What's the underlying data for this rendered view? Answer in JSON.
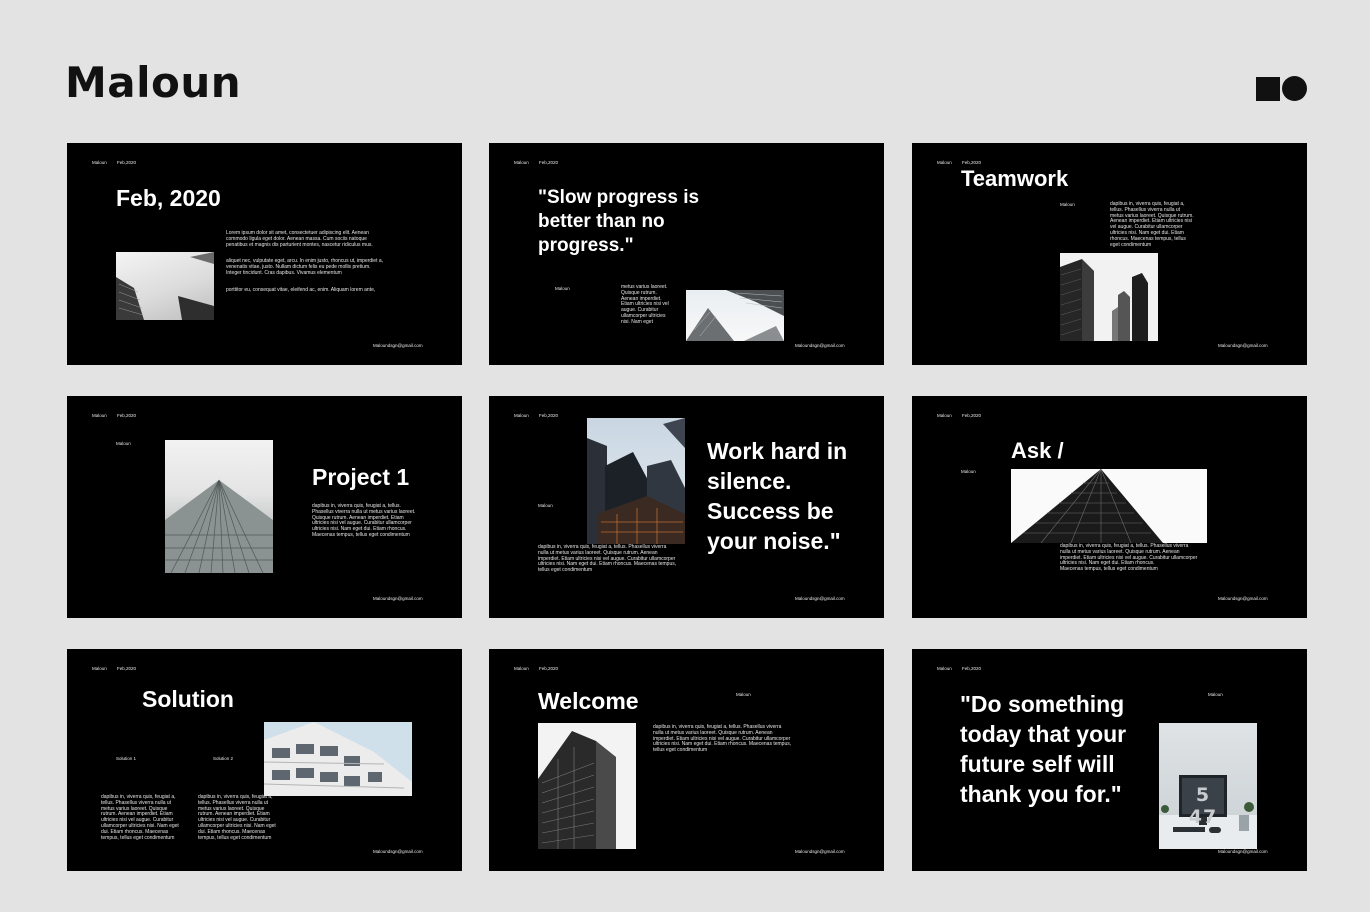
{
  "brand": "Maloun",
  "logo_icon": "square-circle-logo",
  "slide_common": {
    "brand": "Maloun",
    "date": "Feb,2020",
    "email": "Maloundsgn@gmail.com"
  },
  "slides": [
    {
      "title": "Feb, 2020",
      "paragraphs": [
        "Lorem ipsum dolor sit amet, consectetuer adipiscing elit. Aenean\ncommodo ligula eget dolor. Aenean massa. Cum sociis natoque\npenatibus et magnis dis parturient montes, nascetur ridiculus mus.",
        "aliquet nec, vulputate eget, arcu. In enim justo, rhoncus ut, imperdiet a,\nvenenatis vitae, justo. Nullam dictum felis eu pede mollis pretium.\nInteger tincidunt. Cras dapibus. Vivamus elementum",
        "porttitor eu, consequat vitae, eleifend ac, enim. Aliquam lorem ante,"
      ]
    },
    {
      "title": "\"Slow progress is\nbetter than no\nprogress.\"",
      "label": "Maloun",
      "paragraph": "metus varius laoreet.\nQuisque rutrum.\nAenean imperdiet.\nEtiam ultricies nisi vel\naugue. Curabitur\nullamcorper ultricies\nnisi. Nam eget"
    },
    {
      "title": "Teamwork",
      "label": "Maloun",
      "paragraph": "dapibus in, viverra quis, feugiat a,\ntellus. Phasellus viverra nulla ut\nmetus varius laoreet. Quisque rutrum.\nAenean imperdiet. Etiam ultricies nisi\nvel augue. Curabitur ullamcorper\nultricies nisi. Nam eget dui. Etiam\nrhoncus. Maecenas tempus, tellus\neget condimentum"
    },
    {
      "title": "Project 1",
      "label": "Maloun",
      "paragraph": "dapibus in, viverra quis, feugiat a, tellus.\nPhasellus viverra nulla ut metus varius laoreet.\nQuisque rutrum. Aenean imperdiet. Etiam\nultricies nisi vel augue. Curabitur ullamcorper\nultricies nisi. Nam eget dui. Etiam rhoncus.\nMaecenas tempus, tellus eget condimentum"
    },
    {
      "title": "Work hard in\nsilence.\nSuccess be\nyour noise.\"",
      "label": "Maloun",
      "paragraph": "dapibus in, viverra quis, feugiat a, tellus. Phasellus viverra\nnulla ut metus varius laoreet. Quisque rutrum. Aenean\nimperdiet. Etiam ultricies nisi vel augue. Curabitur ullamcorper\nultricies nisi. Nam eget dui. Etiam rhoncus. Maecenas tempus,\ntellus eget condimentum"
    },
    {
      "title": "Ask /",
      "label": "Maloun",
      "paragraph": "dapibus in, viverra quis, feugiat a, tellus. Phasellus viverra\nnulla ut metus varius laoreet. Quisque rutrum. Aenean\nimperdiet. Etiam ultricies nisi vel augue. Curabitur ullamcorper\nultricies nisi. Nam eget dui. Etiam rhoncus.\nMaecenas tempus, tellus eget condimentum"
    },
    {
      "title": "Solution",
      "label1": "Solution 1",
      "label2": "Solution 2",
      "paragraph1": "dapibus in, viverra quis, feugiat a,\ntellus. Phasellus viverra nulla ut\nmetus varius laoreet. Quisque\nrutrum. Aenean imperdiet. Etiam\nultricies nisi vel augue. Curabitur\nullamcorper ultricies nisi. Nam eget\ndui. Etiam rhoncus. Maecenas\ntempus, tellus eget condimentum",
      "paragraph2": "dapibus in, viverra quis, feugiat a,\ntellus. Phasellus viverra nulla ut\nmetus varius laoreet. Quisque\nrutrum. Aenean imperdiet. Etiam\nultricies nisi vel augue. Curabitur\nullamcorper ultricies nisi. Nam eget\ndui. Etiam rhoncus. Maecenas\ntempus, tellus eget condimentum"
    },
    {
      "title": "Welcome",
      "label": "Maloun",
      "paragraph": "dapibus in, viverra quis, feugiat a, tellus. Phasellus viverra\nnulla ut metus varius laoreet. Quisque rutrum. Aenean\nimperdiet. Etiam ultricies nisi vel augue. Curabitur ullamcorper\nultricies nisi. Nam eget dui. Etiam rhoncus. Maecenas tempus,\ntellus eget condimentum"
    },
    {
      "title": "\"Do something\ntoday that your\nfuture self will\nthank you for.\"",
      "label": "Maloun",
      "clock_text": "5 47"
    }
  ]
}
